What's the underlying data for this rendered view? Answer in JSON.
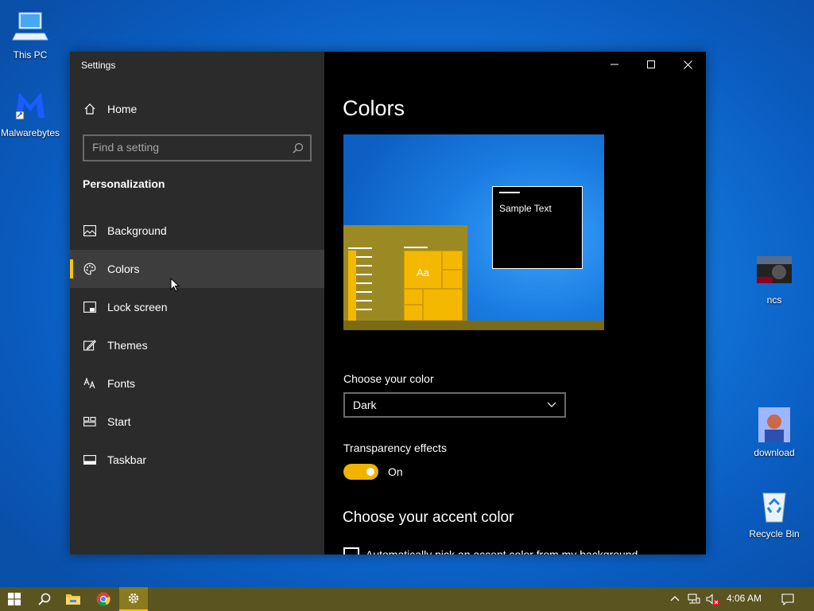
{
  "desktop": {
    "icons": [
      {
        "label": "This PC"
      },
      {
        "label": "Malwarebytes"
      },
      {
        "label": "ncs"
      },
      {
        "label": "download"
      },
      {
        "label": "Recycle Bin"
      }
    ]
  },
  "window": {
    "title": "Settings",
    "controls": {
      "minimize": "minimize-icon",
      "maximize": "maximize-icon",
      "close": "close-icon"
    }
  },
  "sidebar": {
    "home": "Home",
    "search_placeholder": "Find a setting",
    "section": "Personalization",
    "items": [
      {
        "label": "Background",
        "icon": "image-icon"
      },
      {
        "label": "Colors",
        "icon": "palette-icon",
        "active": true
      },
      {
        "label": "Lock screen",
        "icon": "lock-screen-icon"
      },
      {
        "label": "Themes",
        "icon": "themes-icon"
      },
      {
        "label": "Fonts",
        "icon": "fonts-icon"
      },
      {
        "label": "Start",
        "icon": "start-icon"
      },
      {
        "label": "Taskbar",
        "icon": "taskbar-icon"
      }
    ]
  },
  "content": {
    "title": "Colors",
    "preview": {
      "sample_text": "Sample Text",
      "tile_text": "Aa"
    },
    "choose_color_label": "Choose your color",
    "choose_color_value": "Dark",
    "transparency_label": "Transparency effects",
    "transparency_state": "On",
    "accent_heading": "Choose your accent color",
    "auto_accent_label": "Automatically pick an accent color from my background"
  },
  "colors": {
    "accent": "#ffc300",
    "sidebar_bg": "#2b2b2b",
    "content_bg": "#000000",
    "taskbar_bg": "#5a5420"
  },
  "taskbar": {
    "clock": "4:06 AM",
    "pinned": [
      "start-icon",
      "search-icon",
      "file-explorer-icon",
      "chrome-icon",
      "settings-icon"
    ]
  }
}
